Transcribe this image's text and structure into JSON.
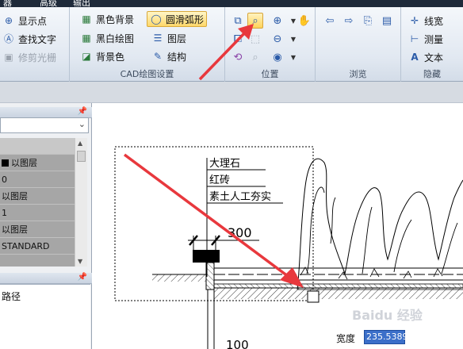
{
  "menubar": {
    "items": [
      "器",
      "高级",
      "输出"
    ]
  },
  "ribbon": {
    "group_tools": {
      "show_points": "显示点",
      "find_text": "查找文字",
      "trim_raster": "修剪光栅"
    },
    "group_cad": {
      "label": "CAD绘图设置",
      "black_bg": "黑色背景",
      "bw_drawing": "黑白绘图",
      "bg_color": "背景色",
      "smooth_arc": "圆滑弧形",
      "layers": "图层",
      "structure": "结构"
    },
    "group_position": {
      "label": "位置"
    },
    "group_browse": {
      "label": "浏览"
    },
    "group_hide": {
      "label": "隐藏",
      "line_width": "线宽",
      "measure": "测量",
      "text": "文本"
    }
  },
  "left_panel": {
    "properties": {
      "rows": [
        "",
        "以图层",
        "0",
        "以图层",
        "1",
        "以图层",
        "STANDARD"
      ]
    },
    "path_label": "路径"
  },
  "canvas": {
    "labels": [
      "大理石",
      "红砖",
      "素土人工夯实"
    ],
    "dim_300": "300",
    "dim_100": "100",
    "width_label": "宽度",
    "width_value": "235.5389",
    "watermark": "Baidu 经验"
  },
  "colors": {
    "accent_red": "#e8383d",
    "highlight": "#ffd86a",
    "ribbon_bg": "#e1e8f1"
  }
}
